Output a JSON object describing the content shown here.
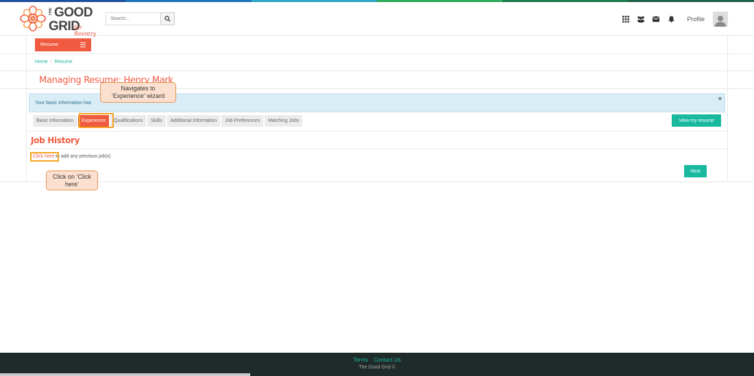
{
  "colors": {
    "accent": "#f05a40",
    "teal": "#19b9a0",
    "alert_bg": "#d9edf7",
    "footer_bg": "#1f2b2a",
    "highlight": "#f3a31e",
    "callout_bg": "#fce0cf",
    "top_strip": [
      "#1e4f9c",
      "#1f73b7",
      "#2aa7c7",
      "#2eaa5a",
      "#1a7a4c",
      "#1b5f45"
    ]
  },
  "logo": {
    "the": "THE",
    "good": "GOOD",
    "grid": "GRID",
    "tagline": "for Reentry"
  },
  "search": {
    "placeholder": "Search..."
  },
  "header": {
    "icons": [
      "grid-icon",
      "users-icon",
      "envelope-icon",
      "bell-icon"
    ],
    "profile_label": "Profile"
  },
  "resume_menu": {
    "label": "Resume"
  },
  "breadcrumb": {
    "home": "Home",
    "sep": "/",
    "current": "Resume"
  },
  "page": {
    "title": "Managing Resume: Henry Mark"
  },
  "alert": {
    "text": "Your basic information has",
    "close": "×"
  },
  "tabs": [
    {
      "label": "Basic Information",
      "active": false
    },
    {
      "label": "Experience",
      "active": true
    },
    {
      "label": "Qualifications",
      "active": false
    },
    {
      "label": "Skills",
      "active": false
    },
    {
      "label": "Additional Information",
      "active": false
    },
    {
      "label": "Job Preferences",
      "active": false
    },
    {
      "label": "Matching Jobs",
      "active": false
    }
  ],
  "view_resume_label": "View my resume",
  "section": {
    "title": "Job History",
    "link_text": "Click here",
    "link_suffix": " to add any previous job(s)"
  },
  "next_label": "Next",
  "callouts": {
    "experience": "Navigates to ‘Experience’ wizard",
    "click_here": "Click on ‘Click here’"
  },
  "footer": {
    "terms": "Terms",
    "contact": "Contact Us",
    "copyright": "The Good Grid ©"
  }
}
